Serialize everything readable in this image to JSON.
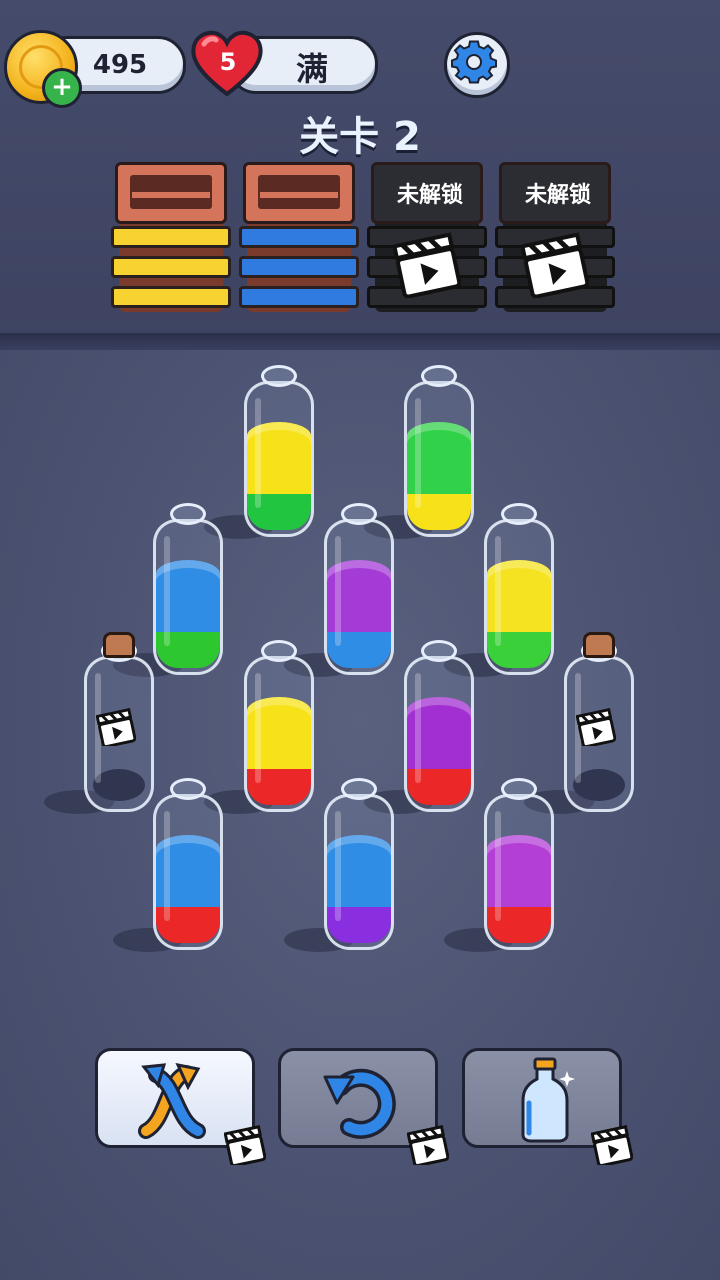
{
  "hud": {
    "coins": "495",
    "lives": "5",
    "lives_status": "满",
    "level_label": "关卡 2"
  },
  "crates": [
    {
      "state": "filled",
      "color": "#f7d331"
    },
    {
      "state": "filled",
      "color": "#2f7be0"
    },
    {
      "state": "locked",
      "label": "未解锁"
    },
    {
      "state": "locked",
      "label": "未解锁"
    }
  ],
  "bottles": [
    {
      "layers": [
        "#22c53f",
        "#f7e21a",
        "#f7e21a"
      ]
    },
    {
      "layers": [
        "#f7e21a",
        "#32d14a",
        "#32d14a"
      ]
    },
    {
      "layers": [
        "#2dc72f",
        "#2f8de6",
        "#2f8de6"
      ]
    },
    {
      "layers": [
        "#2f8de6",
        "#a43bd6",
        "#a43bd6"
      ]
    },
    {
      "layers": [
        "#3ad03a",
        "#f5e321",
        "#f5e321"
      ]
    },
    {
      "locked": true
    },
    {
      "layers": [
        "#ec2727",
        "#f7e21a",
        "#f7e21a"
      ]
    },
    {
      "layers": [
        "#ec2727",
        "#a22fd1",
        "#a22fd1"
      ]
    },
    {
      "locked": true
    },
    {
      "layers": [
        "#ec2727",
        "#2f8de6",
        "#2f8de6"
      ]
    },
    {
      "layers": [
        "#8a2fe0",
        "#2f8de6",
        "#2f8de6"
      ]
    },
    {
      "layers": [
        "#ec2727",
        "#b33fd6",
        "#b33fd6"
      ]
    }
  ],
  "tools": {
    "shuffle": "shuffle",
    "undo": "undo",
    "add_bottle": "add-bottle"
  }
}
